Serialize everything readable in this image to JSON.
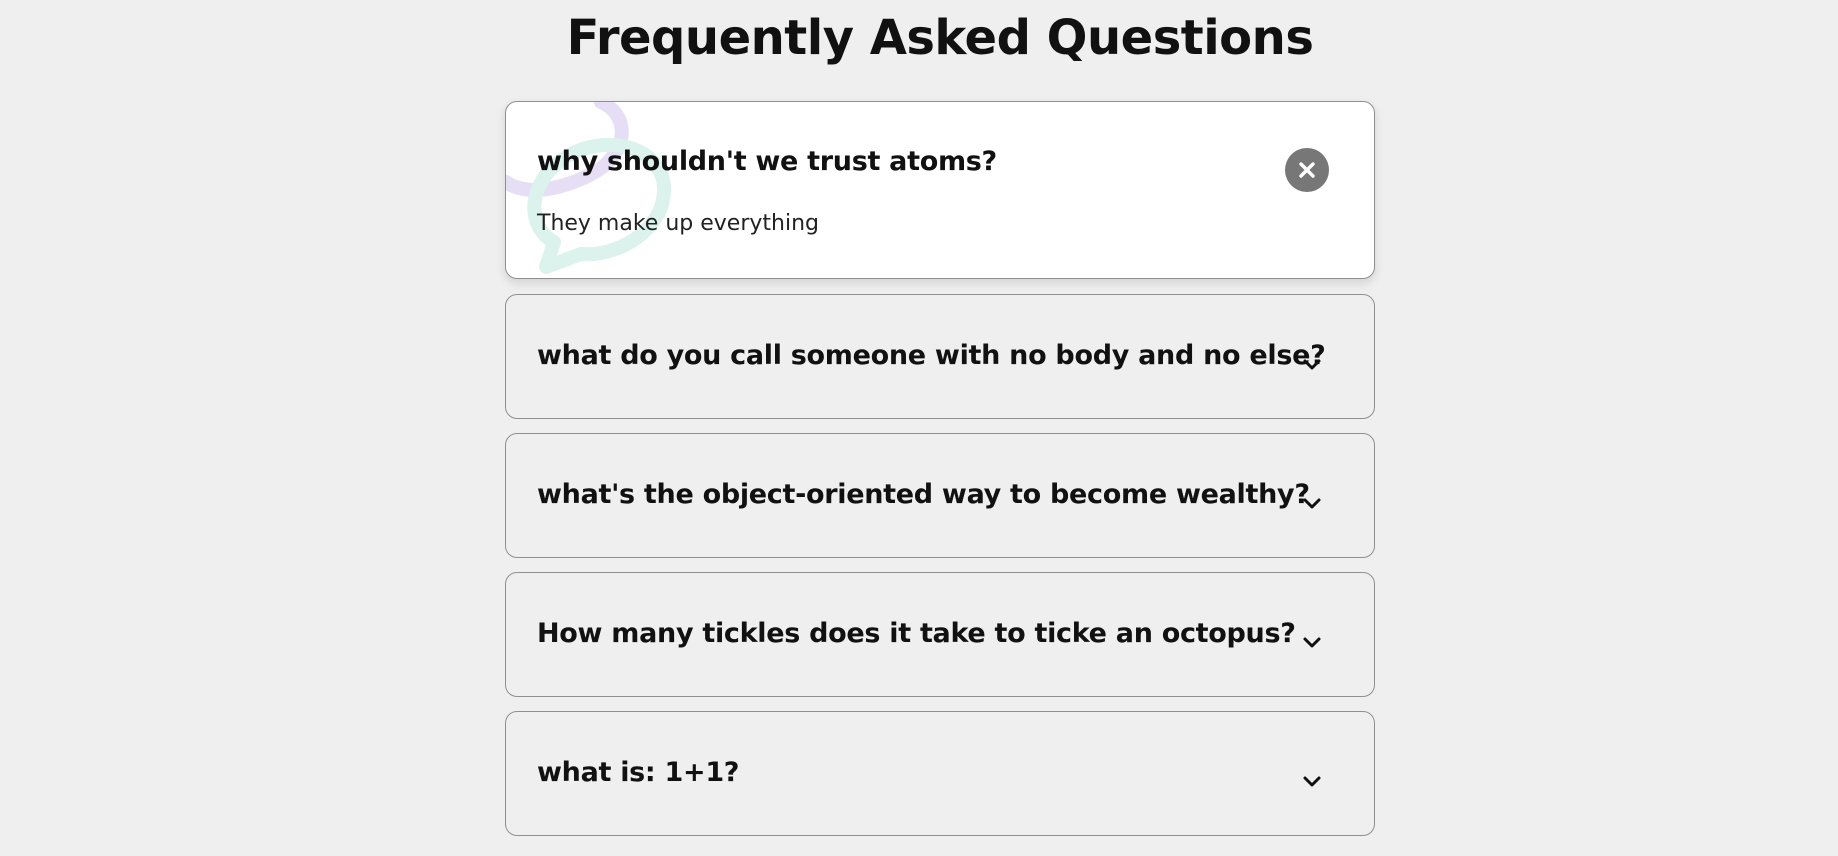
{
  "page": {
    "title": "Frequently Asked Questions"
  },
  "faq": [
    {
      "question": "why shouldn't we trust atoms?",
      "answer": "They make up everything",
      "expanded": true,
      "icon": "close-icon"
    },
    {
      "question": "what do you call someone with no body and no else?",
      "expanded": false,
      "icon": "chevron-down-icon"
    },
    {
      "question": "what's the object-oriented way to become wealthy?",
      "expanded": false,
      "icon": "chevron-down-icon"
    },
    {
      "question": "How many tickles does it take to ticke an octopus?",
      "expanded": false,
      "icon": "chevron-down-icon"
    },
    {
      "question": "what is: 1+1?",
      "expanded": false,
      "icon": "chevron-down-icon"
    }
  ],
  "colors": {
    "background": "#efefef",
    "card_active": "#ffffff",
    "close_button": "#777777",
    "deco_purple": "#e6def5",
    "deco_teal": "#dcf2ec"
  }
}
